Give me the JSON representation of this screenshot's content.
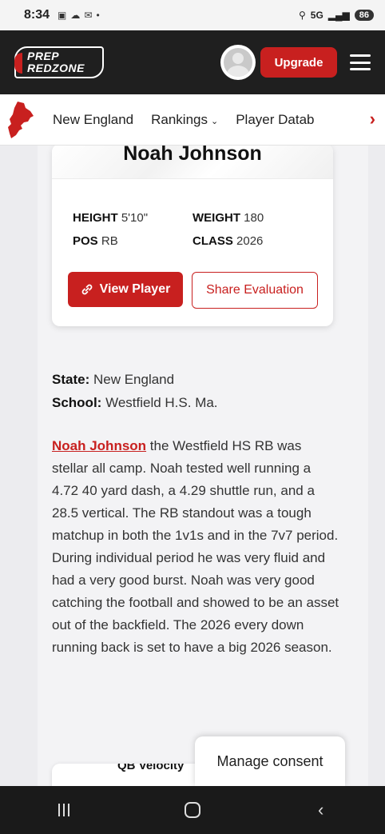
{
  "status_bar": {
    "time": "8:34",
    "network": "5G",
    "battery": "86"
  },
  "header": {
    "logo_line1": "PREP",
    "logo_line2": "REDZONE",
    "upgrade_label": "Upgrade"
  },
  "nav": {
    "items": [
      {
        "label": "New England"
      },
      {
        "label": "Rankings"
      },
      {
        "label": "Player Datab"
      }
    ]
  },
  "player": {
    "name": "Noah Johnson",
    "height_label": "HEIGHT",
    "height_value": "5'10\"",
    "weight_label": "WEIGHT",
    "weight_value": "180",
    "pos_label": "POS",
    "pos_value": "RB",
    "class_label": "CLASS",
    "class_value": "2026",
    "view_button": "View Player",
    "share_button": "Share Evaluation"
  },
  "info": {
    "state_label": "State:",
    "state_value": "New England",
    "school_label": "School:",
    "school_value": "Westfield H.S. Ma."
  },
  "article": {
    "link_text": "Noah Johnson",
    "body": "the Westfield HS RB was stellar all camp. Noah tested well running a 4.72 40 yard dash, a 4.29 shuttle run, and a 28.5 vertical. The RB standout was a tough matchup in both the 1v1s and in the 7v7 period. During individual period he was very fluid and had a very good burst. Noah was very good catching the football and showed to be an asset out of the backfield. The 2026 every down running back is set to have a big 2026 season."
  },
  "next_card_title": "QB Velocity",
  "consent_label": "Manage consent"
}
